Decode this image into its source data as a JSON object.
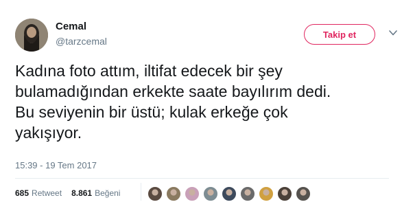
{
  "user": {
    "display_name": "Cemal",
    "handle": "@tarzcemal"
  },
  "follow_button": {
    "label": "Takip et"
  },
  "tweet": {
    "text": "Kadına foto attım, iltifat edecek bir şey\nbulamadığından erkekte saate bayılırım dedi.\nBu seviyenin bir üstü; kulak erkeğe çok\nyakışıyor.",
    "timestamp": "15:39 - 19 Tem 2017"
  },
  "stats": {
    "retweet_count": "685",
    "retweet_label": "Retweet",
    "like_count": "8.861",
    "like_label": "Beğeni"
  },
  "liker_avatars": [
    {
      "color": "#5a4a40"
    },
    {
      "color": "#8a7a60"
    },
    {
      "color": "#c9a0b8"
    },
    {
      "color": "#7d8c92"
    },
    {
      "color": "#3d4a5c"
    },
    {
      "color": "#6a6a6a"
    },
    {
      "color": "#d0a040"
    },
    {
      "color": "#4a4038"
    },
    {
      "color": "#55524e"
    }
  ],
  "colors": {
    "accent": "#e0245e",
    "secondary_text": "#657786",
    "primary_text": "#14171a"
  }
}
